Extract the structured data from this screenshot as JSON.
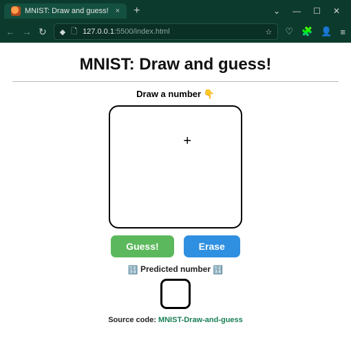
{
  "browser": {
    "tab_title": "MNIST: Draw and guess!",
    "new_tab_glyph": "+",
    "window_controls": {
      "chevron": "⌄",
      "min": "―",
      "max": "☐",
      "close": "✕"
    },
    "nav": {
      "back": "←",
      "forward": "→",
      "reload": "↻"
    },
    "url": {
      "shield": "◆",
      "lock": "🗋",
      "host": "127.0.0.1",
      "path": ":5500/index.html",
      "star": "☆"
    },
    "right_icons": {
      "pocket": "♡",
      "puzzle": "🧩",
      "account": "👤",
      "menu": "≡"
    }
  },
  "page": {
    "title": "MNIST: Draw and guess!",
    "prompt_text": "Draw a number ",
    "prompt_emoji": "👇",
    "cursor_glyph": "+",
    "buttons": {
      "guess": "Guess!",
      "erase": "Erase"
    },
    "predicted_label": " Predicted number ",
    "predicted_emoji": "🔢",
    "source_prefix": "Source code: ",
    "source_link_text": "MNIST-Draw-and-guess"
  }
}
